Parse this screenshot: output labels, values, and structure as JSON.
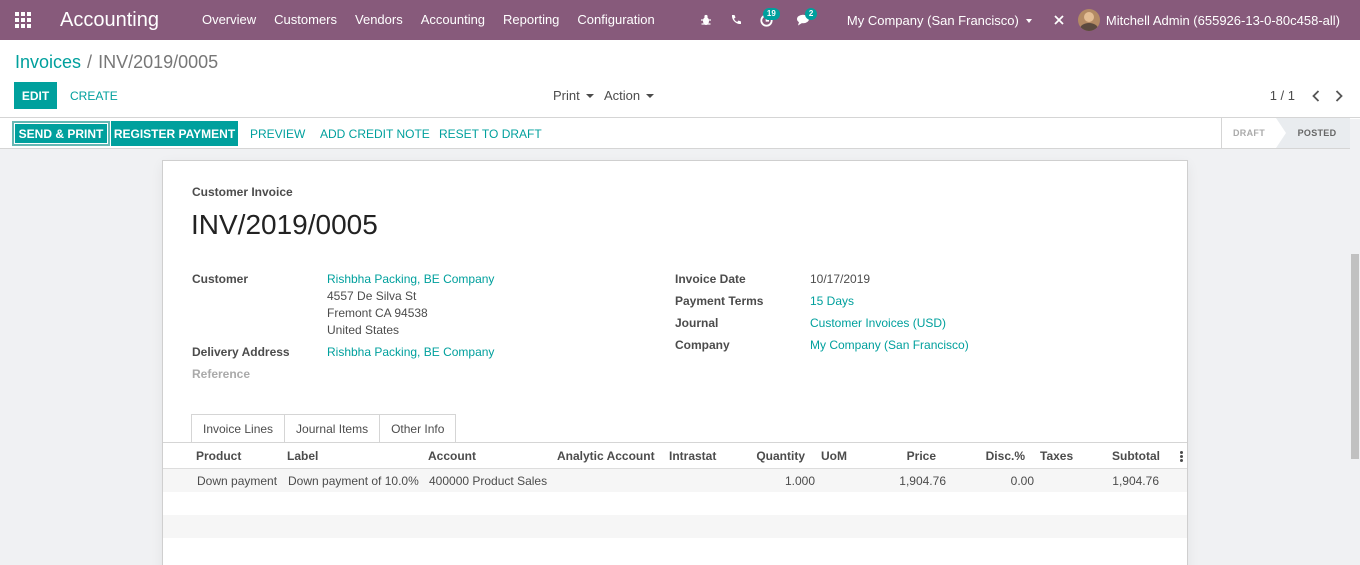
{
  "navbar": {
    "app_title": "Accounting",
    "menu": [
      "Overview",
      "Customers",
      "Vendors",
      "Accounting",
      "Reporting",
      "Configuration"
    ],
    "activity_count": "19",
    "message_count": "2",
    "company": "My Company (San Francisco)",
    "user": "Mitchell Admin (655926-13-0-80c458-all)"
  },
  "breadcrumb": {
    "parent": "Invoices",
    "separator": "/",
    "current": "INV/2019/0005"
  },
  "control": {
    "edit": "EDIT",
    "create": "CREATE",
    "print": "Print",
    "action": "Action",
    "pager": "1 / 1"
  },
  "statusbar": {
    "buttons": [
      "SEND & PRINT",
      "REGISTER PAYMENT",
      "PREVIEW",
      "ADD CREDIT NOTE",
      "RESET TO DRAFT"
    ],
    "stages": [
      "DRAFT",
      "POSTED"
    ],
    "active_stage": "POSTED"
  },
  "invoice": {
    "type": "Customer Invoice",
    "number": "INV/2019/0005",
    "customer_label": "Customer",
    "customer_name": "Rishbha Packing, BE Company",
    "address": [
      "4557 De Silva St",
      "Fremont CA 94538",
      "United States"
    ],
    "delivery_label": "Delivery Address",
    "delivery_value": "Rishbha Packing, BE Company",
    "reference_label": "Reference",
    "invoice_date_label": "Invoice Date",
    "invoice_date": "10/17/2019",
    "payment_terms_label": "Payment Terms",
    "payment_terms": "15 Days",
    "journal_label": "Journal",
    "journal": "Customer Invoices (USD)",
    "company_label": "Company",
    "company": "My Company (San Francisco)"
  },
  "tabs": [
    "Invoice Lines",
    "Journal Items",
    "Other Info"
  ],
  "lines": {
    "columns": [
      "Product",
      "Label",
      "Account",
      "Analytic Account",
      "Intrastat",
      "Quantity",
      "UoM",
      "Price",
      "Disc.%",
      "Taxes",
      "Subtotal"
    ],
    "rows": [
      {
        "product": "Down payment",
        "label": "Down payment of 10.0%",
        "account": "400000 Product Sales",
        "analytic": "",
        "intrastat": "",
        "quantity": "1.000",
        "uom": "",
        "price": "1,904.76",
        "discount": "0.00",
        "taxes": "",
        "subtotal": "1,904.76"
      }
    ]
  },
  "colors": {
    "navbar": "#875a7b",
    "accent": "#00a09d"
  }
}
